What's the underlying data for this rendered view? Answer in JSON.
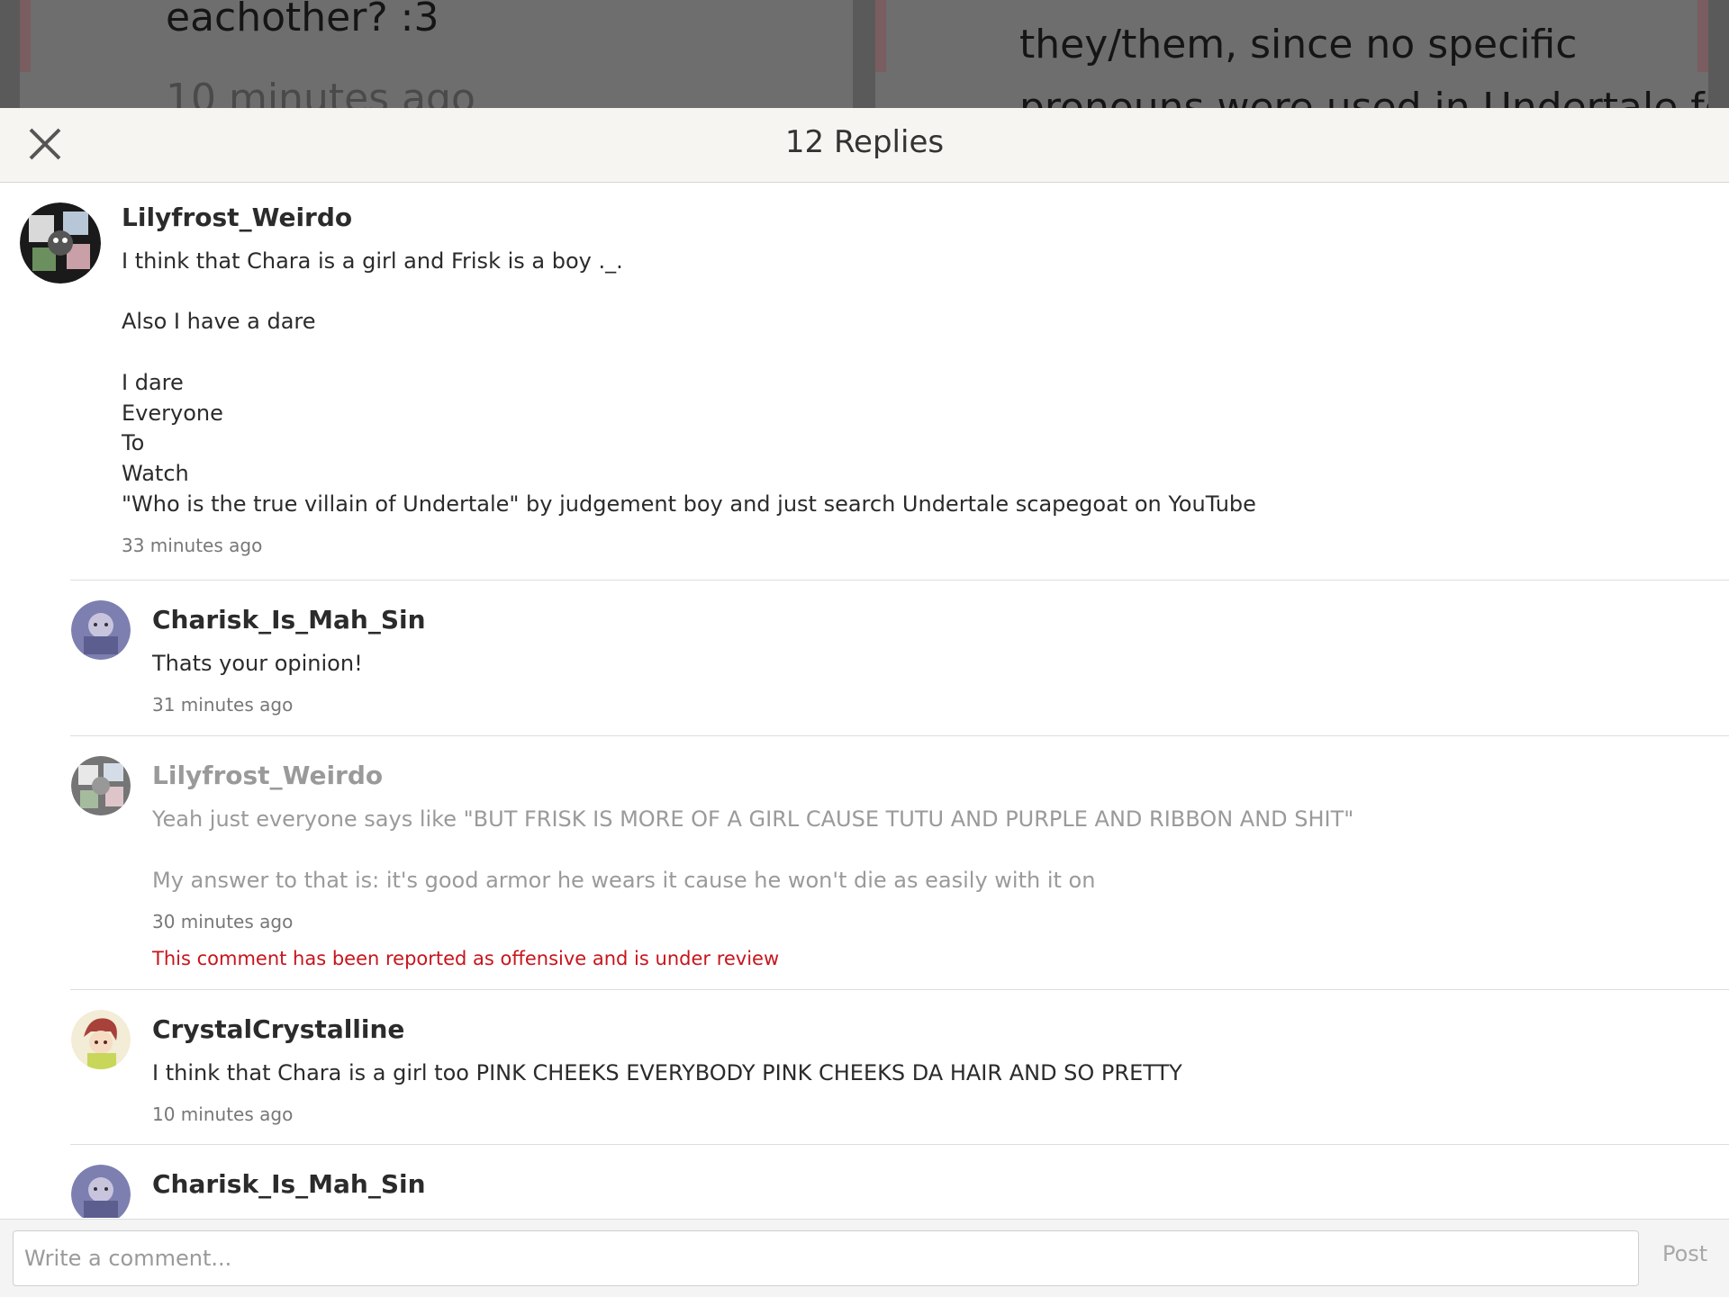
{
  "background": {
    "left_line1": "eachother? :3",
    "left_line2": "10 minutes ago",
    "right_line1": "they/them, since no specific",
    "right_line2": "pronouns were used in Undertale for"
  },
  "header": {
    "title": "12 Replies",
    "close_icon": "close-icon"
  },
  "comments": [
    {
      "author": "Lilyfrost_Weirdo",
      "lines": [
        "I think that Chara is a girl and Frisk is a boy ._.",
        "",
        "Also I have a dare",
        "",
        "I dare",
        "Everyone",
        "To",
        "Watch",
        "\"Who is the true villain of Undertale\" by judgement boy and just search Undertale scapegoat on YouTube"
      ],
      "time": "33 minutes ago"
    },
    {
      "author": "Charisk_Is_Mah_Sin",
      "lines": [
        "Thats your opinion!"
      ],
      "time": "31 minutes ago"
    },
    {
      "author": "Lilyfrost_Weirdo",
      "lines": [
        "Yeah just everyone says like \"BUT FRISK IS MORE OF A GIRL CAUSE TUTU AND PURPLE AND RIBBON AND SHIT\"",
        "",
        "My answer to that is: it's good armor he wears it cause he won't die as easily with it on"
      ],
      "time": "30 minutes ago",
      "flag": "This comment has been reported as offensive and is under review"
    },
    {
      "author": "CrystalCrystalline",
      "lines": [
        "I think that Chara is a girl too PINK CHEEKS EVERYBODY PINK CHEEKS DA HAIR AND SO PRETTY"
      ],
      "time": "10 minutes ago"
    },
    {
      "author": "Charisk_Is_Mah_Sin"
    }
  ],
  "footer": {
    "placeholder": "Write a comment...",
    "post_label": "Post"
  },
  "colors": {
    "flag": "#c8141c",
    "header_bg": "#f6f5f1"
  }
}
